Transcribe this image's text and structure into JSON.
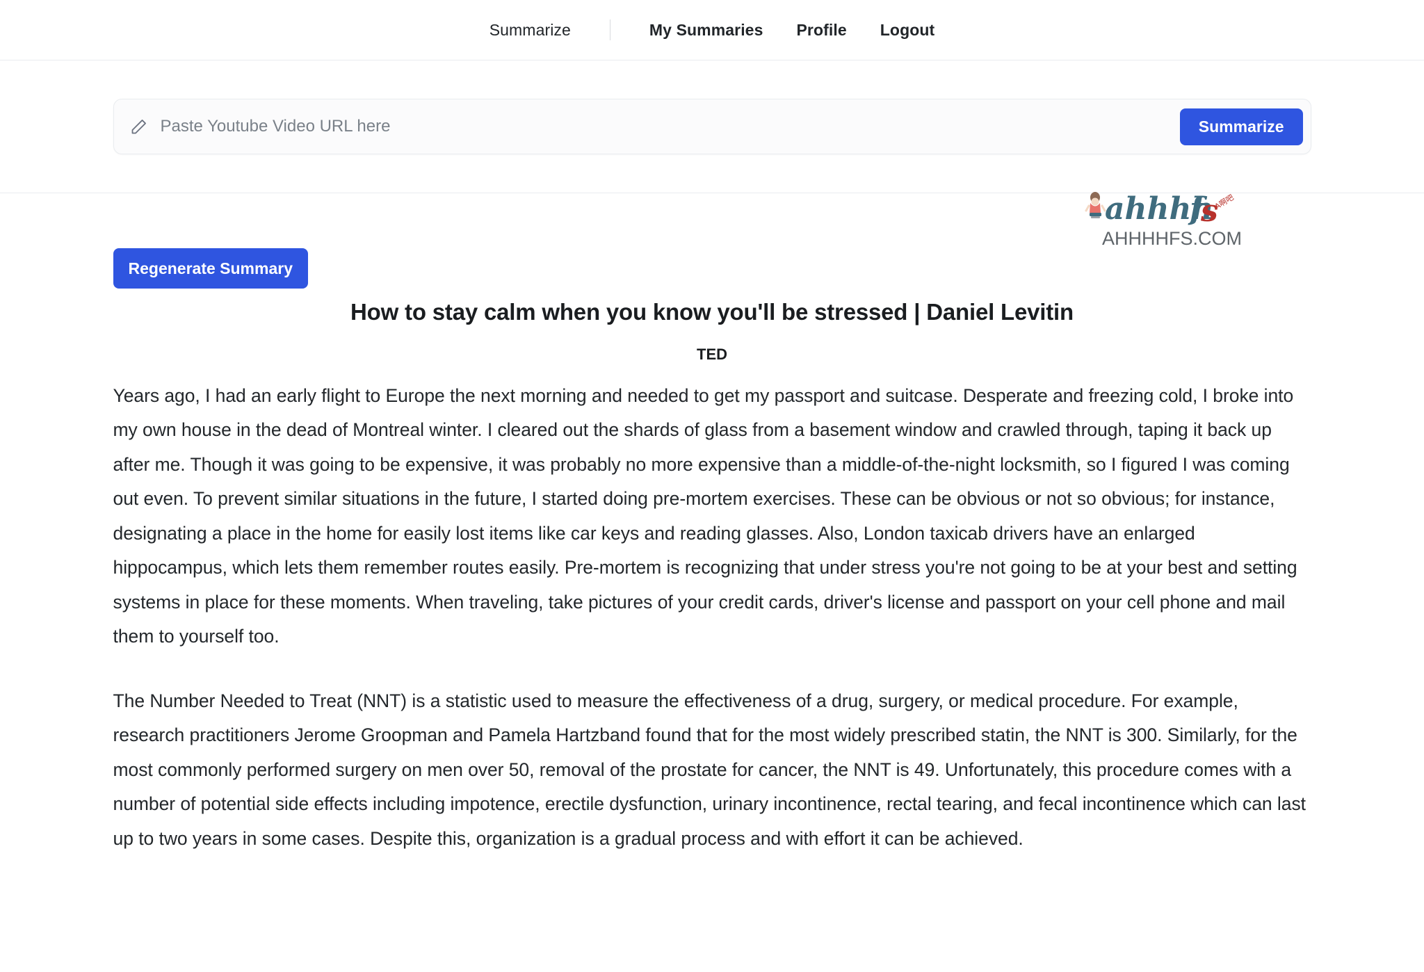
{
  "nav": {
    "items": [
      {
        "label": "Summarize",
        "style": "plain",
        "name": "nav-link-summarize"
      },
      {
        "label": "My Summaries",
        "style": "bold",
        "name": "nav-link-my-summaries"
      },
      {
        "label": "Profile",
        "style": "bold",
        "name": "nav-link-profile"
      },
      {
        "label": "Logout",
        "style": "bold",
        "name": "nav-link-logout"
      }
    ]
  },
  "search": {
    "icon": "pencil-icon",
    "placeholder": "Paste Youtube Video URL here",
    "value": "",
    "submit_label": "Summarize"
  },
  "actions": {
    "regenerate_label": "Regenerate Summary"
  },
  "video": {
    "title": "How to stay calm when you know you'll be stressed | Daniel Levitin",
    "channel": "TED"
  },
  "summary": {
    "paragraphs": [
      "Years ago, I had an early flight to Europe the next morning and needed to get my passport and suitcase. Desperate and freezing cold, I broke into my own house in the dead of Montreal winter. I cleared out the shards of glass from a basement window and crawled through, taping it back up after me. Though it was going to be expensive, it was probably no more expensive than a middle-of-the-night locksmith, so I figured I was coming out even. To prevent similar situations in the future, I started doing pre-mortem exercises. These can be obvious or not so obvious; for instance, designating a place in the home for easily lost items like car keys and reading glasses. Also, London taxicab drivers have an enlarged hippocampus, which lets them remember routes easily. Pre-mortem is recognizing that under stress you're not going to be at your best and setting systems in place for these moments. When traveling, take pictures of your credit cards, driver's license and passport on your cell phone and mail them to yourself too.",
      "The Number Needed to Treat (NNT) is a statistic used to measure the effectiveness of a drug, surgery, or medical procedure. For example, research practitioners Jerome Groopman and Pamela Hartzband found that for the most widely prescribed statin, the NNT is 300. Similarly, for the most commonly performed surgery on men over 50, removal of the prostate for cancer, the NNT is 49. Unfortunately, this procedure comes with a number of potential side effects including impotence, erectile dysfunction, urinary incontinence, rectal tearing, and fecal incontinence which can last up to two years in some cases. Despite this, organization is a gradual process and with effort it can be achieved."
    ]
  },
  "watermark": {
    "wordmark": "ahhhhfs",
    "domain": "AHHHHFS.COM",
    "badge": "A啊吧",
    "colors": {
      "teal": "#3f6c7e",
      "red": "#b8322c",
      "gray": "#5e6469"
    }
  },
  "colors": {
    "accent": "#2f55e0",
    "text": "#23272b",
    "border": "#e9ecef",
    "placeholder": "#7a8189",
    "input_bg": "#fbfbfc"
  }
}
